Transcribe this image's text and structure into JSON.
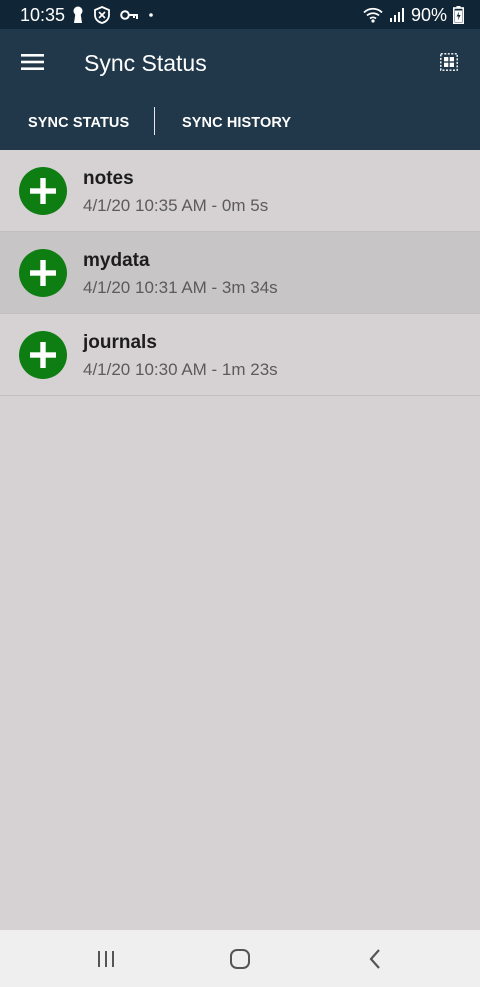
{
  "status_bar": {
    "time": "10:35",
    "battery_percent": "90%",
    "left_icons": [
      "keyhole-icon",
      "shield-icon",
      "key-icon",
      "dot-icon"
    ],
    "right_icons": [
      "wifi-icon",
      "signal-icon",
      "battery-charging-icon"
    ]
  },
  "app_bar": {
    "title": "Sync Status",
    "menu_icon": "hamburger-menu-icon",
    "action_icon": "grid-view-icon"
  },
  "tabs": [
    {
      "label": "SYNC STATUS",
      "selected": true
    },
    {
      "label": "SYNC HISTORY",
      "selected": false
    }
  ],
  "sync_items": [
    {
      "name": "notes",
      "detail": "4/1/20 10:35 AM - 0m 5s",
      "icon": "add-circle-icon",
      "selected": false
    },
    {
      "name": "mydata",
      "detail": "4/1/20 10:31 AM - 3m 34s",
      "icon": "add-circle-icon",
      "selected": true
    },
    {
      "name": "journals",
      "detail": "4/1/20 10:30 AM - 1m 23s",
      "icon": "add-circle-icon",
      "selected": false
    }
  ],
  "nav_bar": {
    "buttons": [
      "recent-apps-icon",
      "home-icon",
      "back-icon"
    ]
  },
  "colors": {
    "status_bar": "#102536",
    "app_bar": "#21384a",
    "list_background": "#d6d2d3",
    "selected_row": "#c8c5c7",
    "add_icon": "#0e7e13"
  }
}
